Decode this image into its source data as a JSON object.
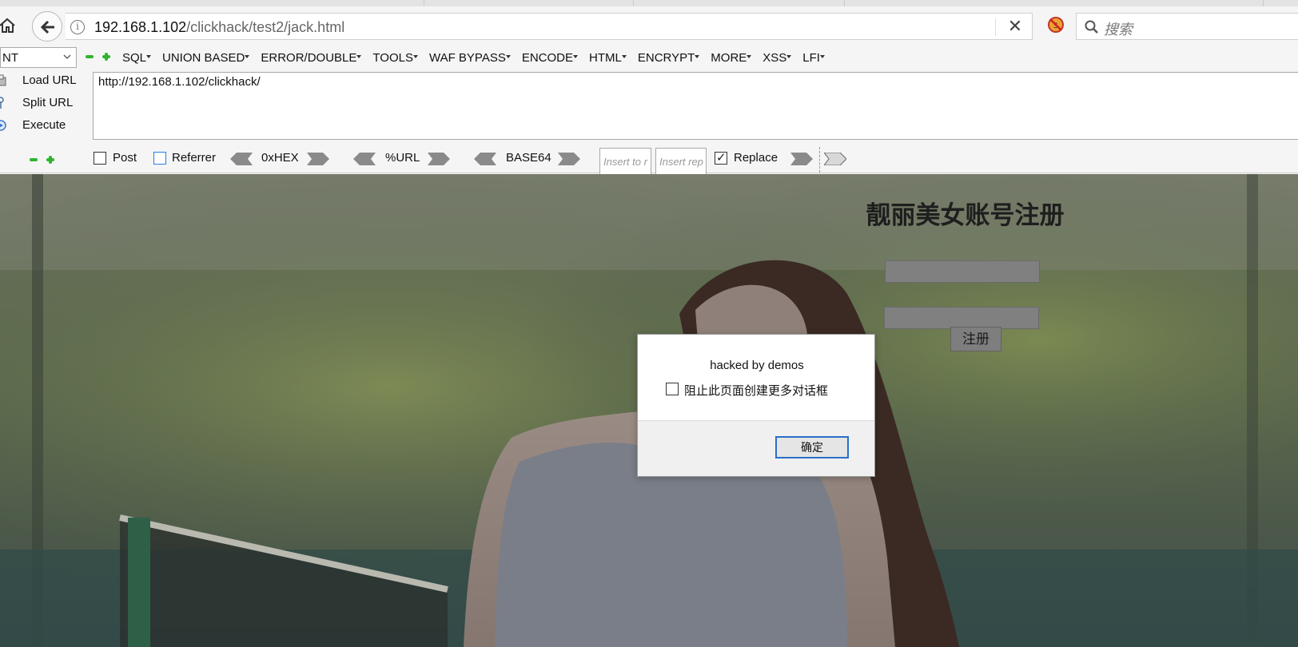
{
  "browser": {
    "url_host": "192.168.1.102",
    "url_path": "/clickhack/test2/jack.html",
    "search_placeholder": "搜索"
  },
  "hackbar": {
    "mode_select": "NT",
    "menus": [
      "SQL",
      "UNION BASED",
      "ERROR/DOUBLE",
      "TOOLS",
      "WAF BYPASS",
      "ENCODE",
      "HTML",
      "ENCRYPT",
      "MORE",
      "XSS",
      "LFI"
    ],
    "load_url": "Load URL",
    "split_url": "Split URL",
    "execute": "Execute",
    "url_value": "http://192.168.1.102/clickhack/",
    "post_label": "Post",
    "post_checked": false,
    "referrer_label": "Referrer",
    "referrer_checked": false,
    "hex_label": "0xHEX",
    "urlenc_label": "%URL",
    "base64_label": "BASE64",
    "insert_placeholder_1": "Insert to r",
    "insert_placeholder_2": "Insert rep",
    "replace_label": "Replace",
    "replace_checked": true
  },
  "page": {
    "title": "靓丽美女账号注册",
    "register_button": "注册"
  },
  "dialog": {
    "message": "hacked by demos",
    "checkbox_label": "阻止此页面创建更多对话框",
    "ok_button": "确定"
  },
  "colors": {
    "dialog_accent": "#2a6fc9",
    "hackbar_green": "#2db52d"
  }
}
